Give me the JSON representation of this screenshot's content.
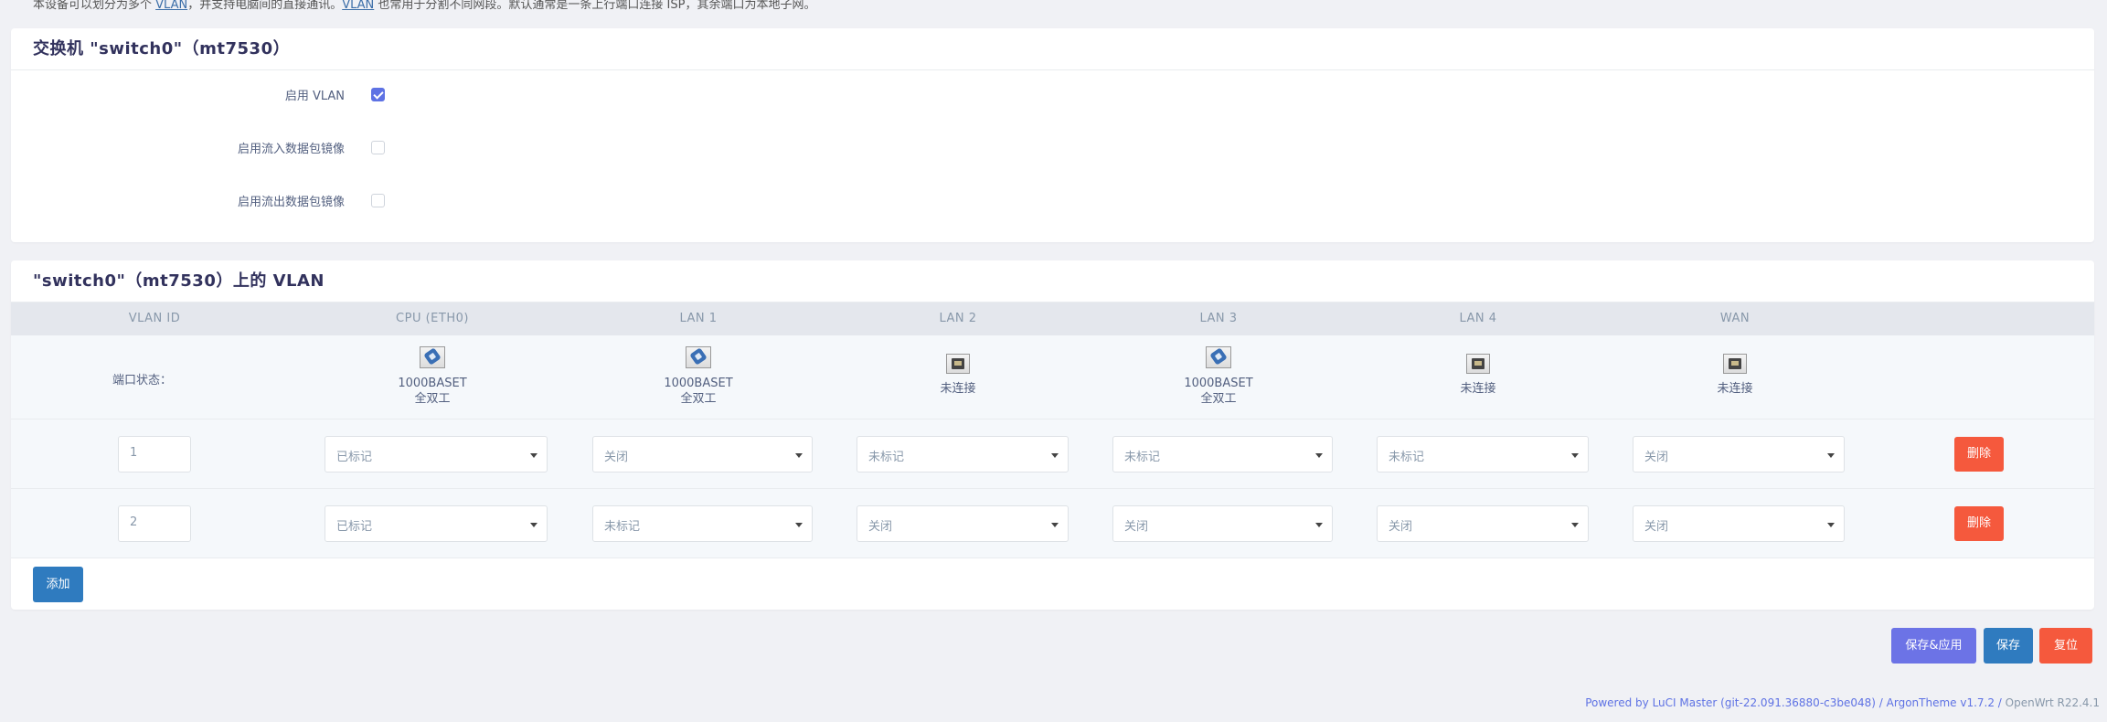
{
  "intro": {
    "text_a": "本设备可以划分为多个 ",
    "link_a": "VLAN",
    "text_b": "，并支持电脑间的直接通讯。",
    "link_b": "VLAN",
    "text_c": " 也常用于分割不同网段。默认通常是一条上行端口连接 ISP，其余端口为本地子网。"
  },
  "switch_card": {
    "title": "交换机 \"switch0\"（mt7530）",
    "options": [
      {
        "label": "启用 VLAN",
        "checked": true
      },
      {
        "label": "启用流入数据包镜像",
        "checked": false
      },
      {
        "label": "启用流出数据包镜像",
        "checked": false
      }
    ]
  },
  "vlan_card": {
    "title": "\"switch0\"（mt7530）上的 VLAN",
    "columns": [
      "VLAN ID",
      "CPU (ETH0)",
      "LAN 1",
      "LAN 2",
      "LAN 3",
      "LAN 4",
      "WAN"
    ],
    "port_status_label": "端口状态：",
    "ports": [
      {
        "icon": "ethernet-connected-icon",
        "speed": "1000BASET",
        "duplex": "全双工"
      },
      {
        "icon": "ethernet-connected-icon",
        "speed": "1000BASET",
        "duplex": "全双工"
      },
      {
        "icon": "ethernet-disconnected-icon",
        "speed": "",
        "duplex": "未连接"
      },
      {
        "icon": "ethernet-connected-icon",
        "speed": "1000BASET",
        "duplex": "全双工"
      },
      {
        "icon": "ethernet-disconnected-icon",
        "speed": "",
        "duplex": "未连接"
      },
      {
        "icon": "ethernet-disconnected-icon",
        "speed": "",
        "duplex": "未连接"
      }
    ],
    "rows": [
      {
        "vlan_id": "1",
        "cells": [
          "已标记",
          "关闭",
          "未标记",
          "未标记",
          "未标记",
          "关闭"
        ],
        "delete_label": "删除"
      },
      {
        "vlan_id": "2",
        "cells": [
          "已标记",
          "未标记",
          "关闭",
          "关闭",
          "关闭",
          "关闭"
        ],
        "delete_label": "删除"
      }
    ],
    "add_label": "添加"
  },
  "actions": {
    "save_apply": "保存&应用",
    "save": "保存",
    "reset": "复位"
  },
  "footer": {
    "powered": "Powered by LuCI Master (git-22.091.36880-c3be048)",
    "sep1": " / ",
    "theme": "ArgonTheme v1.7.2",
    "sep2": " / ",
    "os": "OpenWrt R22.4.1"
  },
  "colors": {
    "accent": "#5e72e4",
    "danger": "#f5593d",
    "primary": "#2f7bbf",
    "save_apply": "#6c73e6"
  }
}
